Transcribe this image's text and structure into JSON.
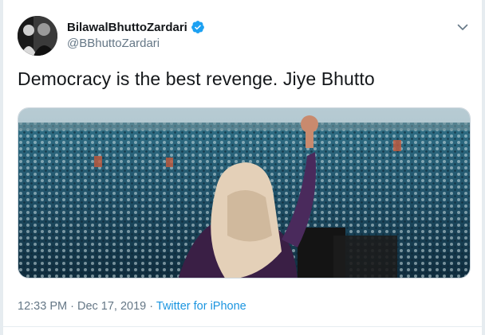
{
  "tweet": {
    "display_name": "BilawalBhuttoZardari",
    "handle": "@BBhuttoZardari",
    "text": "Democracy is the best revenge. Jiye Bhutto",
    "time": "12:33 PM",
    "separator": "·",
    "date": "Dec 17, 2019",
    "source": "Twitter for iPhone"
  },
  "icons": {
    "verified": "verified-badge-icon",
    "more": "chevron-down-icon"
  },
  "colors": {
    "text": "#14171a",
    "muted": "#657786",
    "link": "#1b95e0",
    "verified": "#1da1f2"
  }
}
